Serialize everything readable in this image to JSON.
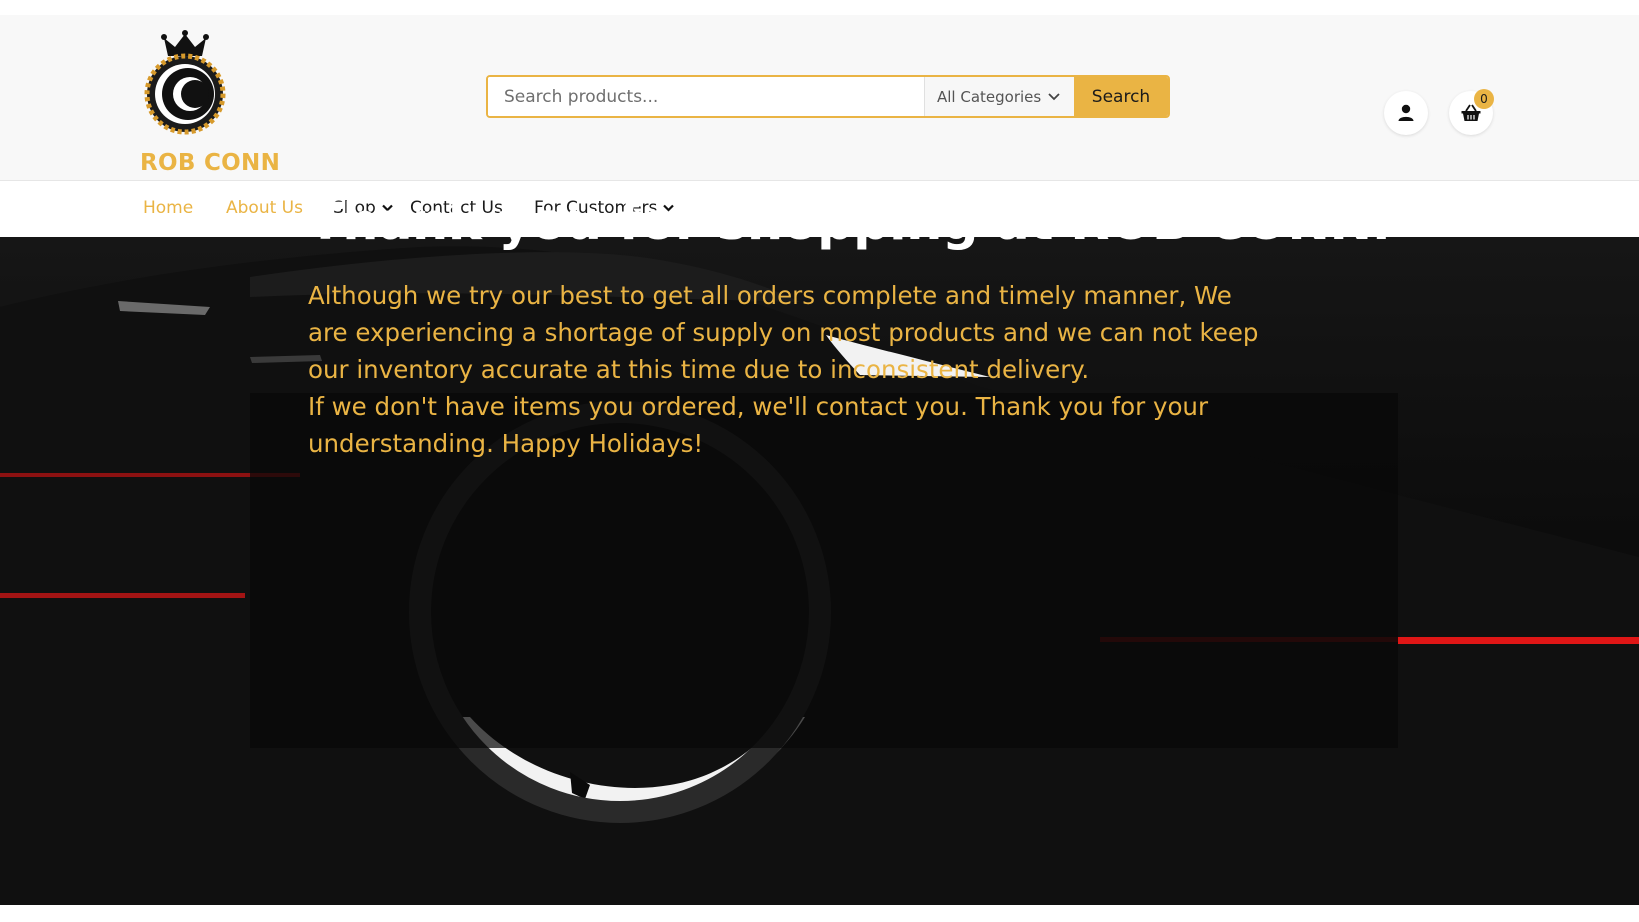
{
  "brand": {
    "name": "ROB CONN"
  },
  "search": {
    "placeholder": "Search products...",
    "category": "All Categories",
    "button_label": "Search"
  },
  "header": {
    "cart_count": "0"
  },
  "nav": {
    "items": [
      {
        "label": "Home",
        "active": true,
        "dropdown": false
      },
      {
        "label": "About Us",
        "active": true,
        "dropdown": false
      },
      {
        "label": "Shop",
        "active": false,
        "dropdown": true
      },
      {
        "label": "Contact Us",
        "active": false,
        "dropdown": false
      },
      {
        "label": "For Customers",
        "active": false,
        "dropdown": true
      }
    ]
  },
  "hero": {
    "title": "Thank you for shopping at ROB CONN.",
    "paragraph1": "Although we try our best to get all orders complete and timely manner, We are experiencing a shortage of supply on most products and we can not keep our inventory accurate at this time due to inconsistent delivery.",
    "paragraph2": "If we don't have items you ordered, we'll contact you. Thank you for your understanding. Happy Holidays!"
  },
  "colors": {
    "accent": "#eab444",
    "hero_bg": "#0c0c0c",
    "header_bg": "#f8f8f8"
  },
  "icons": {
    "account": "user-icon",
    "cart": "basket-icon",
    "dropdown": "chevron-down-icon",
    "logo": "crown-tire-logo"
  }
}
